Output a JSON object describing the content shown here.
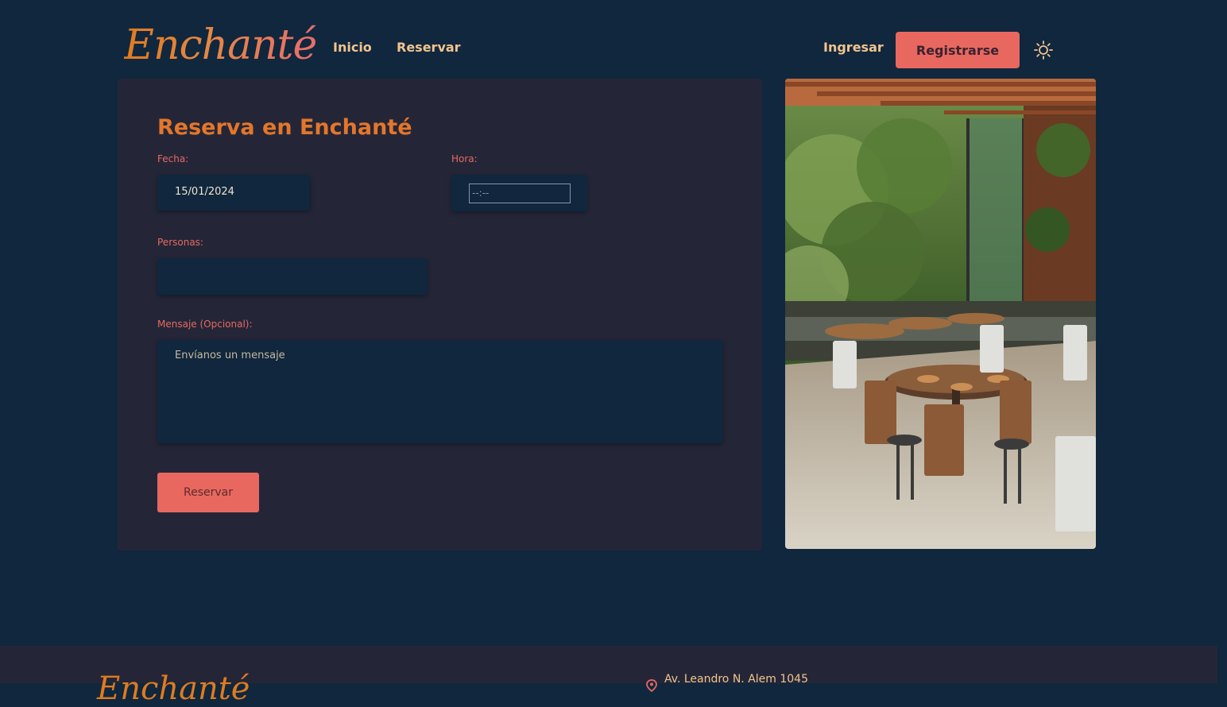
{
  "header": {
    "logo_text": "Enchanté",
    "nav": {
      "inicio": "Inicio",
      "reservar": "Reservar",
      "ingresar": "Ingresar",
      "registrarse": "Registrarse"
    },
    "theme_toggle_icon": "sun-icon"
  },
  "form": {
    "title": "Reserva en Enchanté",
    "fecha_label": "Fecha:",
    "fecha_value": "15/01/2024",
    "hora_label": "Hora:",
    "hora_placeholder": "--:--",
    "personas_label": "Personas:",
    "personas_value": "",
    "mensaje_label": "Mensaje (Opcional):",
    "mensaje_placeholder": "Envíanos un mensaje",
    "submit_label": "Reservar"
  },
  "footer": {
    "logo_text": "Enchanté",
    "address": "Av. Leandro N. Alem 1045",
    "address_icon": "location-pin-icon"
  },
  "colors": {
    "background": "#10273e",
    "card": "#242638",
    "accent": "#e8685f",
    "title": "#e4762a",
    "nav_text": "#f2c48d"
  }
}
